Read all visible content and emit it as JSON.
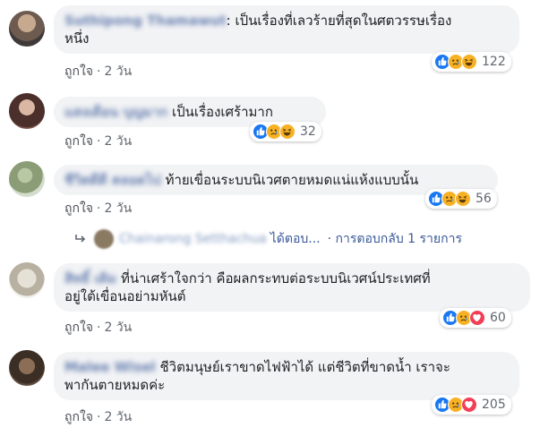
{
  "comments": [
    {
      "author": "Suthipong Thamawut",
      "text1": ": เป็นเรื่องที่เลวร้ายที่สุดในศตวรรษเรื่อง",
      "text2": "หนึ่ง",
      "like": "ถูกใจ",
      "time": "2 วัน",
      "reaction_count": "122",
      "reaction_icons": [
        "like-icon",
        "sad-icon",
        "haha-icon"
      ]
    },
    {
      "author": "แสงเดือน บุญมาก",
      "text1": " เป็นเรื่องเศร้ามาก",
      "like": "ถูกใจ",
      "time": "2 วัน",
      "reaction_count": "32",
      "reaction_icons": [
        "like-icon",
        "sad-icon",
        "haha-icon"
      ]
    },
    {
      "author": "ชีวิตดีดี ตลอดไป",
      "text1": " ท้ายเขื่อนระบบนิเวศตายหมดแน่แห้งแบบนั้น",
      "like": "ถูกใจ",
      "time": "2 วัน",
      "reaction_count": "56",
      "reaction_icons": [
        "like-icon",
        "sad-icon",
        "haha-icon"
      ]
    },
    {
      "author": "สิทธิ์ เดิม",
      "text1": " ที่น่าเศร้าใจกว่า คือผลกระทบต่อระบบนิเวศน์ประเทศที่",
      "text2": "อยู่ใต้เขื่อนอย่ามหันต์",
      "like": "ถูกใจ",
      "time": "2 วัน",
      "reaction_count": "60",
      "reaction_icons": [
        "like-icon",
        "sad-icon",
        "love-icon"
      ]
    },
    {
      "author": "Malee Wisel",
      "text1": " ชีวิตมนุษย์เราขาดไฟฟ้าได้ แต่ชีวิตที่ขาดน้ำ เราจะ",
      "text2": "พากันตายหมดค่ะ",
      "like": "ถูกใจ",
      "time": "2 วัน",
      "reaction_count": "205",
      "reaction_icons": [
        "like-icon",
        "sad-icon",
        "love-icon"
      ]
    }
  ],
  "reply": {
    "name": "Chainarong Setthachua",
    "action": "ได้ตอบ...",
    "count_text": "· การตอบกลับ 1 รายการ"
  },
  "colors": {
    "link": "#385898",
    "bubble": "#f2f3f5",
    "meta": "#606770",
    "like_blue": "#1877f2",
    "sad_yellow": "#f7b125",
    "love_red": "#f33e58"
  }
}
